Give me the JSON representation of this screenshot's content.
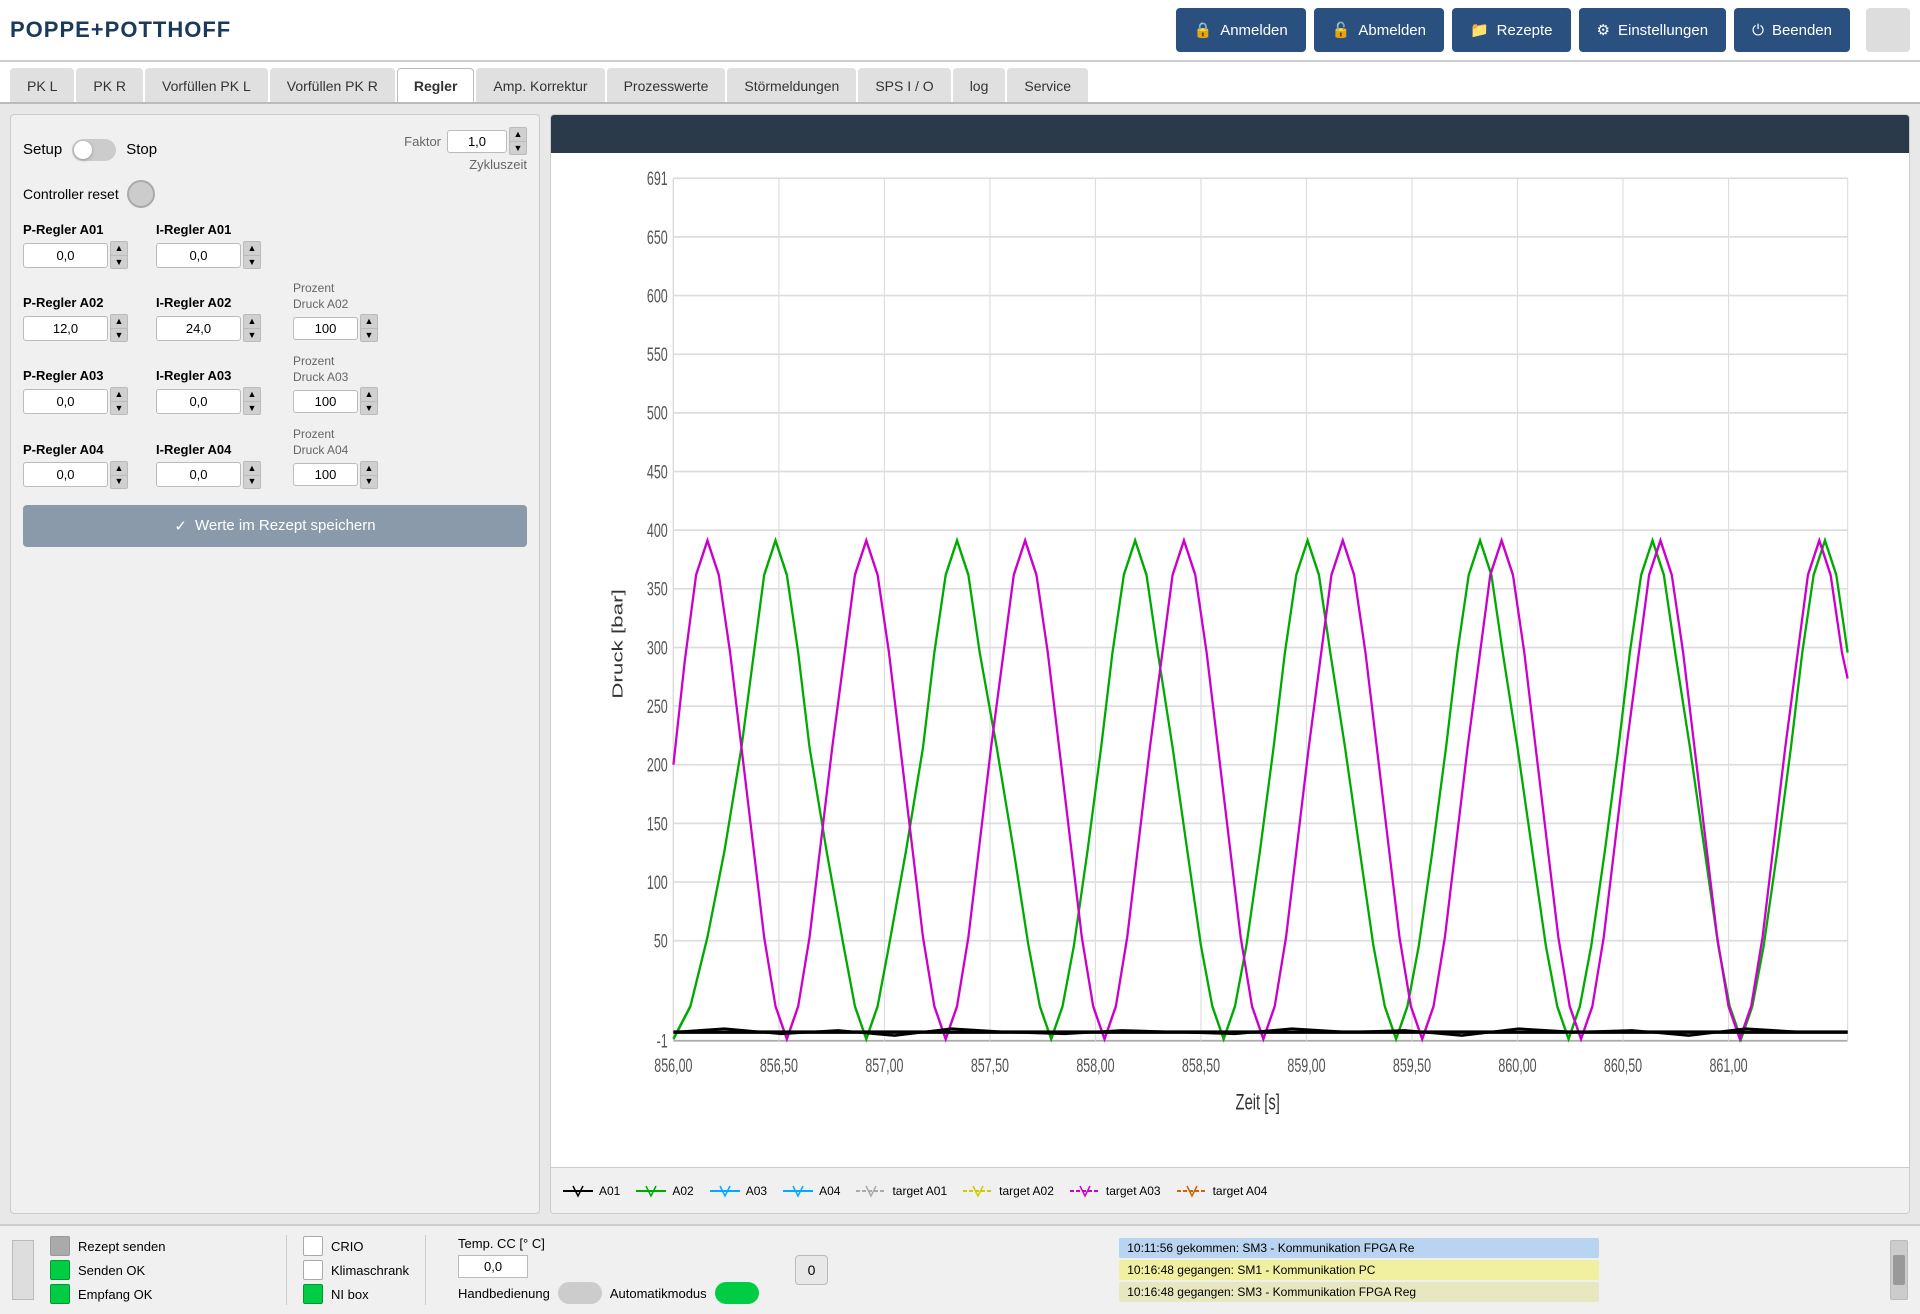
{
  "header": {
    "logo": "POPPE+POTTHOFF",
    "buttons": [
      {
        "id": "anmelden",
        "label": "Anmelden",
        "icon": "🔒"
      },
      {
        "id": "abmelden",
        "label": "Abmelden",
        "icon": "🔓"
      },
      {
        "id": "rezepte",
        "label": "Rezepte",
        "icon": "📁"
      },
      {
        "id": "einstellungen",
        "label": "Einstellungen",
        "icon": "⚙"
      },
      {
        "id": "beenden",
        "label": "Beenden",
        "icon": "⏻"
      }
    ]
  },
  "nav_tabs": [
    {
      "id": "pk-l",
      "label": "PK L",
      "active": false
    },
    {
      "id": "pk-r",
      "label": "PK R",
      "active": false
    },
    {
      "id": "vorfuellen-pk-l",
      "label": "Vorfüllen PK L",
      "active": false
    },
    {
      "id": "vorfuellen-pk-r",
      "label": "Vorfüllen PK R",
      "active": false
    },
    {
      "id": "regler",
      "label": "Regler",
      "active": true
    },
    {
      "id": "amp-korrektur",
      "label": "Amp. Korrektur",
      "active": false
    },
    {
      "id": "prozesswerte",
      "label": "Prozesswerte",
      "active": false
    },
    {
      "id": "stoermeldungen",
      "label": "Störmeldungen",
      "active": false
    },
    {
      "id": "sps-io",
      "label": "SPS I / O",
      "active": false
    },
    {
      "id": "log",
      "label": "log",
      "active": false
    },
    {
      "id": "service",
      "label": "Service",
      "active": false
    }
  ],
  "controls": {
    "setup_label": "Setup",
    "stop_label": "Stop",
    "factor_label": "Faktor",
    "zykluszeit_label": "Zykluszeit",
    "faktor_value": "1,0",
    "controller_reset_label": "Controller reset",
    "regler_rows": [
      {
        "p_label": "P-Regler A01",
        "i_label": "I-Regler A01",
        "p_value": "0,0",
        "i_value": "0,0",
        "prozent_label": null,
        "prozent_value": null
      },
      {
        "p_label": "P-Regler A02",
        "i_label": "I-Regler A02",
        "p_value": "12,0",
        "i_value": "24,0",
        "prozent_label": "Prozent\nDruck A02",
        "prozent_value": "100"
      },
      {
        "p_label": "P-Regler A03",
        "i_label": "I-Regler A03",
        "p_value": "0,0",
        "i_value": "0,0",
        "prozent_label": "Prozent\nDruck A03",
        "prozent_value": "100"
      },
      {
        "p_label": "P-Regler A04",
        "i_label": "I-Regler A04",
        "p_value": "0,0",
        "i_value": "0,0",
        "prozent_label": "Prozent\nDruck A04",
        "prozent_value": "100"
      }
    ],
    "save_btn_label": "Werte im Rezept speichern"
  },
  "chart": {
    "y_label": "Druck [bar]",
    "x_label": "Zeit [s]",
    "y_max": 691,
    "y_ticks": [
      691,
      650,
      600,
      550,
      500,
      450,
      400,
      350,
      300,
      250,
      200,
      150,
      100,
      50,
      -1
    ],
    "x_ticks": [
      "856,00",
      "856,50",
      "857,00",
      "857,50",
      "858,00",
      "858,50",
      "859,00",
      "859,50",
      "860,00",
      "860,50",
      "861,00"
    ],
    "legend": [
      {
        "id": "a01",
        "label": "A01",
        "color": "#000000",
        "style": "solid"
      },
      {
        "id": "a02",
        "label": "A02",
        "color": "#00aa00",
        "style": "solid"
      },
      {
        "id": "a03",
        "label": "A03",
        "color": "#00aaff",
        "style": "solid"
      },
      {
        "id": "a04",
        "label": "A04",
        "color": "#00aaff",
        "style": "solid"
      },
      {
        "id": "target-a01",
        "label": "target A01",
        "color": "#cccccc",
        "style": "dashed"
      },
      {
        "id": "target-a02",
        "label": "target A02",
        "color": "#cccc00",
        "style": "dashed"
      },
      {
        "id": "target-a03",
        "label": "target A03",
        "color": "#cc00cc",
        "style": "dashed"
      },
      {
        "id": "target-a04",
        "label": "target A04",
        "color": "#cc6600",
        "style": "dashed"
      }
    ]
  },
  "status_bar": {
    "indicators": [
      {
        "label": "Rezept senden",
        "dot_class": "dot-gray"
      },
      {
        "label": "Senden OK",
        "dot_class": "dot-green"
      },
      {
        "label": "Empfang OK",
        "dot_class": "dot-green"
      }
    ],
    "crio_label": "CRIO",
    "klimaschrank_label": "Klimaschrank",
    "ni_box_label": "NI box",
    "crio_dot": "dot-white",
    "klimaschrank_dot": "dot-white",
    "ni_box_dot": "dot-green",
    "temp_label": "Temp. CC [° C]",
    "temp_value": "0,0",
    "handbedienung_label": "Handbedienung",
    "automatikmodus_label": "Automatikmodus",
    "zero_btn_label": "0",
    "log_messages": [
      {
        "text": "10:11:56 gekommen: SM3 - Kommunikation FPGA Re",
        "style": "blue"
      },
      {
        "text": "10:16:48 gegangen: SM1 - Kommunikation PC",
        "style": "yellow"
      },
      {
        "text": "10:16:48 gegangen: SM3 - Kommunikation FPGA Reg",
        "style": "yellow2"
      }
    ]
  }
}
